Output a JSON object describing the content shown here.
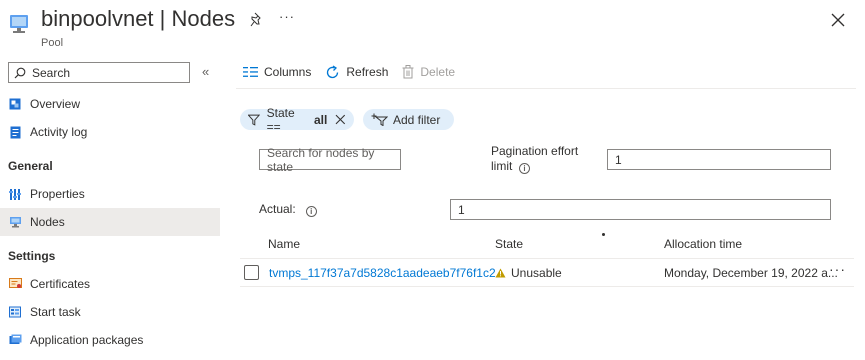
{
  "header": {
    "title": "binpoolvnet | Nodes",
    "subtitle": "Pool",
    "more_label": "···"
  },
  "sidebar": {
    "search_placeholder": "Search",
    "collapse_label": "«",
    "items_top": [
      {
        "label": "Overview"
      },
      {
        "label": "Activity log"
      }
    ],
    "general_heading": "General",
    "general_items": [
      {
        "label": "Properties"
      },
      {
        "label": "Nodes"
      }
    ],
    "settings_heading": "Settings",
    "settings_items": [
      {
        "label": "Certificates"
      },
      {
        "label": "Start task"
      },
      {
        "label": "Application packages"
      }
    ],
    "active_item": "Nodes"
  },
  "toolbar": {
    "columns_label": "Columns",
    "refresh_label": "Refresh",
    "delete_label": "Delete"
  },
  "filters": {
    "state_prefix": "State == ",
    "state_value": "all",
    "add_filter_label": "Add filter"
  },
  "form": {
    "search_placeholder": "Search for nodes by state",
    "pagination_label_line1": "Pagination effort",
    "pagination_label_line2": "limit",
    "pagination_value": "1",
    "actual_label": "Actual:",
    "actual_value": "1"
  },
  "table": {
    "headers": {
      "name": "Name",
      "state": "State",
      "allocation": "Allocation time"
    },
    "rows": [
      {
        "name": "tvmps_117f37a7d5828c1aadeaeb7f76f1c2...",
        "state": "Unusable",
        "allocation": "Monday, December 19, 2022 a..."
      }
    ],
    "row_more_label": "···"
  },
  "colors": {
    "accent": "#0078d4",
    "pill_bg": "#e1eefa",
    "warning": "#c19c00",
    "active_bg": "#edebe9"
  }
}
